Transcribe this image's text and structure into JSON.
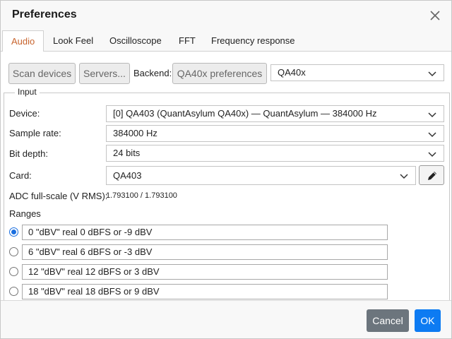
{
  "dialog": {
    "title": "Preferences"
  },
  "tabs": [
    {
      "label": "Audio"
    },
    {
      "label": "Look Feel"
    },
    {
      "label": "Oscilloscope"
    },
    {
      "label": "FFT"
    },
    {
      "label": "Frequency response"
    }
  ],
  "toolbar": {
    "scan_label": "Scan devices",
    "servers_label": "Servers...",
    "backend_label": "Backend:",
    "backend_prefs_label": "QA40x preferences",
    "backend_value": "QA40x"
  },
  "input": {
    "legend": "Input",
    "device_label": "Device:",
    "device_value": "[0] QA403 (QuantAsylum QA40x) — QuantAsylum — 384000 Hz",
    "sample_rate_label": "Sample rate:",
    "sample_rate_value": "384000 Hz",
    "bit_depth_label": "Bit depth:",
    "bit_depth_value": "24 bits",
    "card_label": "Card:",
    "card_value": "QA403",
    "adc_label": "ADC full-scale (V RMS):",
    "adc_value": "1.793100 / 1.793100",
    "ranges_label": "Ranges",
    "ranges": [
      {
        "value": "0 \"dBV\" real 0 dBFS or -9 dBV",
        "selected": true
      },
      {
        "value": "6 \"dBV\" real 6 dBFS or -3 dBV",
        "selected": false
      },
      {
        "value": "12 \"dBV\" real 12 dBFS or 3 dBV",
        "selected": false
      },
      {
        "value": "18 \"dBV\" real 18 dBFS or 9 dBV",
        "selected": false
      }
    ]
  },
  "footer": {
    "cancel_label": "Cancel",
    "ok_label": "OK"
  },
  "colors": {
    "accent": "#1a6fe0",
    "active_tab": "#c8642e",
    "cancel_bg": "#6c757d",
    "ok_bg": "#0d7bf2"
  },
  "icons": {
    "close": "close-icon",
    "chevron": "chevron-down-icon",
    "edit": "pencil-icon"
  }
}
